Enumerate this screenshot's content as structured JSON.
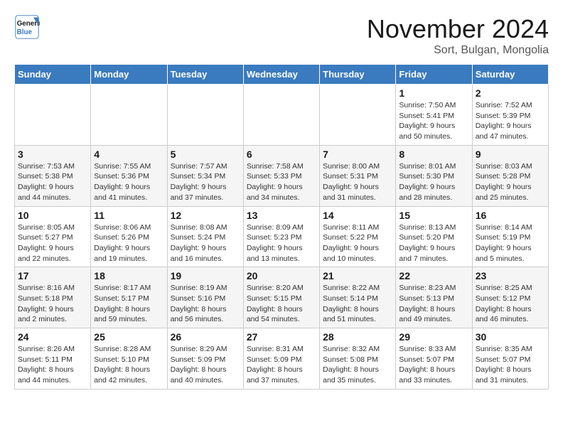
{
  "logo": {
    "line1": "General",
    "line2": "Blue"
  },
  "title": "November 2024",
  "location": "Sort, Bulgan, Mongolia",
  "header_color": "#3a7abf",
  "weekdays": [
    "Sunday",
    "Monday",
    "Tuesday",
    "Wednesday",
    "Thursday",
    "Friday",
    "Saturday"
  ],
  "weeks": [
    [
      {
        "day": "",
        "info": ""
      },
      {
        "day": "",
        "info": ""
      },
      {
        "day": "",
        "info": ""
      },
      {
        "day": "",
        "info": ""
      },
      {
        "day": "",
        "info": ""
      },
      {
        "day": "1",
        "info": "Sunrise: 7:50 AM\nSunset: 5:41 PM\nDaylight: 9 hours and 50 minutes."
      },
      {
        "day": "2",
        "info": "Sunrise: 7:52 AM\nSunset: 5:39 PM\nDaylight: 9 hours and 47 minutes."
      }
    ],
    [
      {
        "day": "3",
        "info": "Sunrise: 7:53 AM\nSunset: 5:38 PM\nDaylight: 9 hours and 44 minutes."
      },
      {
        "day": "4",
        "info": "Sunrise: 7:55 AM\nSunset: 5:36 PM\nDaylight: 9 hours and 41 minutes."
      },
      {
        "day": "5",
        "info": "Sunrise: 7:57 AM\nSunset: 5:34 PM\nDaylight: 9 hours and 37 minutes."
      },
      {
        "day": "6",
        "info": "Sunrise: 7:58 AM\nSunset: 5:33 PM\nDaylight: 9 hours and 34 minutes."
      },
      {
        "day": "7",
        "info": "Sunrise: 8:00 AM\nSunset: 5:31 PM\nDaylight: 9 hours and 31 minutes."
      },
      {
        "day": "8",
        "info": "Sunrise: 8:01 AM\nSunset: 5:30 PM\nDaylight: 9 hours and 28 minutes."
      },
      {
        "day": "9",
        "info": "Sunrise: 8:03 AM\nSunset: 5:28 PM\nDaylight: 9 hours and 25 minutes."
      }
    ],
    [
      {
        "day": "10",
        "info": "Sunrise: 8:05 AM\nSunset: 5:27 PM\nDaylight: 9 hours and 22 minutes."
      },
      {
        "day": "11",
        "info": "Sunrise: 8:06 AM\nSunset: 5:26 PM\nDaylight: 9 hours and 19 minutes."
      },
      {
        "day": "12",
        "info": "Sunrise: 8:08 AM\nSunset: 5:24 PM\nDaylight: 9 hours and 16 minutes."
      },
      {
        "day": "13",
        "info": "Sunrise: 8:09 AM\nSunset: 5:23 PM\nDaylight: 9 hours and 13 minutes."
      },
      {
        "day": "14",
        "info": "Sunrise: 8:11 AM\nSunset: 5:22 PM\nDaylight: 9 hours and 10 minutes."
      },
      {
        "day": "15",
        "info": "Sunrise: 8:13 AM\nSunset: 5:20 PM\nDaylight: 9 hours and 7 minutes."
      },
      {
        "day": "16",
        "info": "Sunrise: 8:14 AM\nSunset: 5:19 PM\nDaylight: 9 hours and 5 minutes."
      }
    ],
    [
      {
        "day": "17",
        "info": "Sunrise: 8:16 AM\nSunset: 5:18 PM\nDaylight: 9 hours and 2 minutes."
      },
      {
        "day": "18",
        "info": "Sunrise: 8:17 AM\nSunset: 5:17 PM\nDaylight: 8 hours and 59 minutes."
      },
      {
        "day": "19",
        "info": "Sunrise: 8:19 AM\nSunset: 5:16 PM\nDaylight: 8 hours and 56 minutes."
      },
      {
        "day": "20",
        "info": "Sunrise: 8:20 AM\nSunset: 5:15 PM\nDaylight: 8 hours and 54 minutes."
      },
      {
        "day": "21",
        "info": "Sunrise: 8:22 AM\nSunset: 5:14 PM\nDaylight: 8 hours and 51 minutes."
      },
      {
        "day": "22",
        "info": "Sunrise: 8:23 AM\nSunset: 5:13 PM\nDaylight: 8 hours and 49 minutes."
      },
      {
        "day": "23",
        "info": "Sunrise: 8:25 AM\nSunset: 5:12 PM\nDaylight: 8 hours and 46 minutes."
      }
    ],
    [
      {
        "day": "24",
        "info": "Sunrise: 8:26 AM\nSunset: 5:11 PM\nDaylight: 8 hours and 44 minutes."
      },
      {
        "day": "25",
        "info": "Sunrise: 8:28 AM\nSunset: 5:10 PM\nDaylight: 8 hours and 42 minutes."
      },
      {
        "day": "26",
        "info": "Sunrise: 8:29 AM\nSunset: 5:09 PM\nDaylight: 8 hours and 40 minutes."
      },
      {
        "day": "27",
        "info": "Sunrise: 8:31 AM\nSunset: 5:09 PM\nDaylight: 8 hours and 37 minutes."
      },
      {
        "day": "28",
        "info": "Sunrise: 8:32 AM\nSunset: 5:08 PM\nDaylight: 8 hours and 35 minutes."
      },
      {
        "day": "29",
        "info": "Sunrise: 8:33 AM\nSunset: 5:07 PM\nDaylight: 8 hours and 33 minutes."
      },
      {
        "day": "30",
        "info": "Sunrise: 8:35 AM\nSunset: 5:07 PM\nDaylight: 8 hours and 31 minutes."
      }
    ]
  ]
}
